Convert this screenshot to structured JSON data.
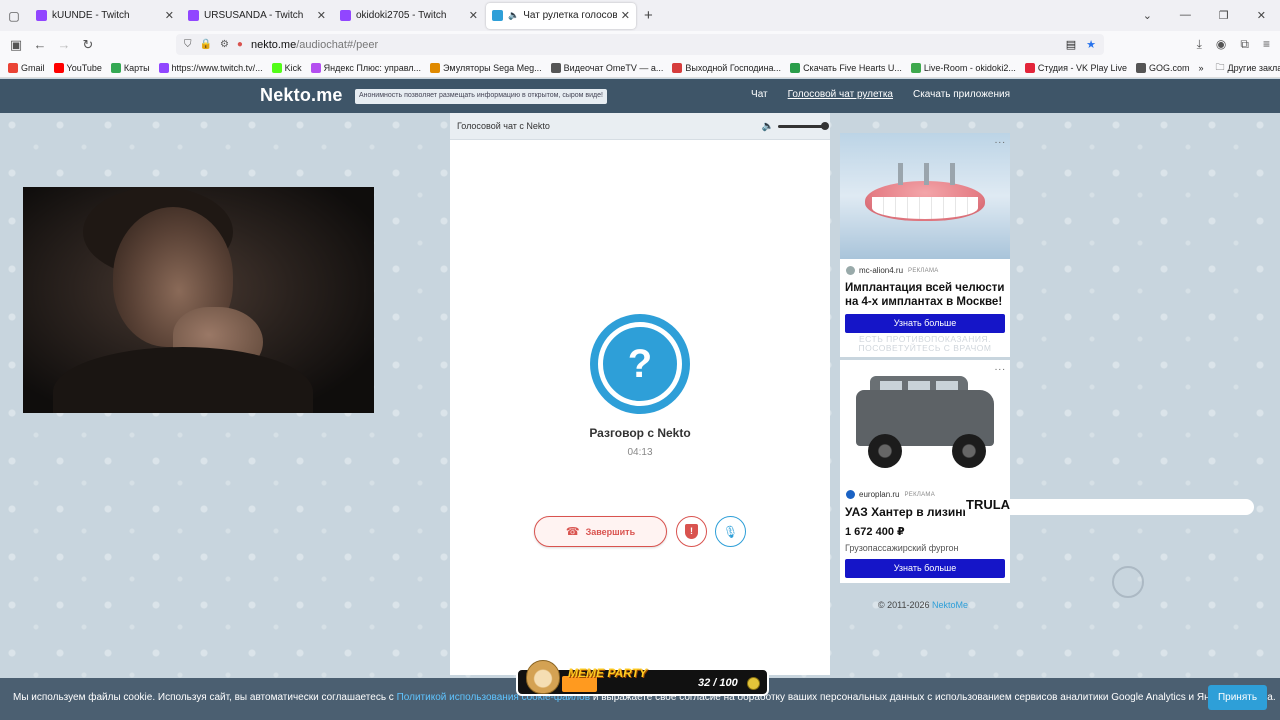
{
  "browser": {
    "tabs": [
      {
        "title": "kUUNDE - Twitch",
        "type": "twitch",
        "active": false
      },
      {
        "title": "URSUSANDA - Twitch",
        "type": "twitch",
        "active": false
      },
      {
        "title": "okidoki2705 - Twitch",
        "type": "twitch",
        "active": false
      },
      {
        "title": "Чат рулетка голосовая -",
        "type": "nekto",
        "active": true
      }
    ],
    "url_host": "nekto.me",
    "url_path": "/audiochat#/peer",
    "bookmarks": [
      {
        "label": "Gmail",
        "color": "#ea4335"
      },
      {
        "label": "YouTube",
        "color": "#ff0000"
      },
      {
        "label": "Карты",
        "color": "#34a853"
      },
      {
        "label": "https://www.twitch.tv/...",
        "color": "#9146ff"
      },
      {
        "label": "Kick",
        "color": "#53fc18"
      },
      {
        "label": "Яндекс Плюс: управл...",
        "color": "#b44ff0"
      },
      {
        "label": "Эмуляторы Sega Meg...",
        "color": "#e08a00"
      },
      {
        "label": "Видеочат OmeTV — а...",
        "color": "#555555"
      },
      {
        "label": "Выходной Господина...",
        "color": "#d63c3c"
      },
      {
        "label": "Скачать Five Hearts U...",
        "color": "#2a9d4a"
      },
      {
        "label": "Live-Room - okidoki2...",
        "color": "#3ea84d"
      },
      {
        "label": "Студия - VK Play Live",
        "color": "#e3253a"
      },
      {
        "label": "GOG.com",
        "color": "#555555"
      }
    ],
    "other_bookmarks": "Другие закладки"
  },
  "site": {
    "logo": "Nekto.me",
    "notice": "Анонимность позволяет размещать информацию в открытом, сыром виде!",
    "nav": [
      "Чат",
      "Голосовой чат рулетка",
      "Скачать приложения"
    ]
  },
  "chat": {
    "header": "Голосовой чат с Nekto",
    "avatar_symbol": "?",
    "partner": "Разговор с Nekto",
    "timer": "04:13",
    "end_label": "Завершить",
    "block_symbol": "!",
    "volume_level": 1.0
  },
  "ads": {
    "ad1": {
      "source": "mc-alion4.ru",
      "tag": "РЕКЛАМА",
      "headline": "Имплантация всей челюсти на 4-х имплантах в Москве!",
      "cta": "Узнать больше",
      "disclaimer": "ЕСТЬ ПРОТИВОПОКАЗАНИЯ. ПОСОВЕТУЙТЕСЬ С ВРАЧОМ"
    },
    "ad2": {
      "source": "europlan.ru",
      "tag": "РЕКЛАМА",
      "headline": "УАЗ Хантер в лизинг",
      "price": "1 672 400 ₽",
      "subtitle": "Грузопассажирский фургон",
      "cta": "Узнать больше"
    },
    "menu_icon": "..."
  },
  "overlay_text": "TRULA",
  "copyright": {
    "text": "© 2011-2026",
    "link": "NektoMe"
  },
  "cookie": {
    "text_before": "Мы используем файлы cookie. Используя сайт, вы автоматически соглашаетесь с ",
    "link": "Политикой использования cookie-файлов",
    "text_after": " и выражаете свое согласие на обработку ваших персональных данных с использованием сервисов аналитики Google Analytics и Яндекс Метрика.",
    "accept": "Принять"
  },
  "meme_party": {
    "title": "MEME PARTY",
    "count": "32 / 100",
    "progress": 0.32
  }
}
